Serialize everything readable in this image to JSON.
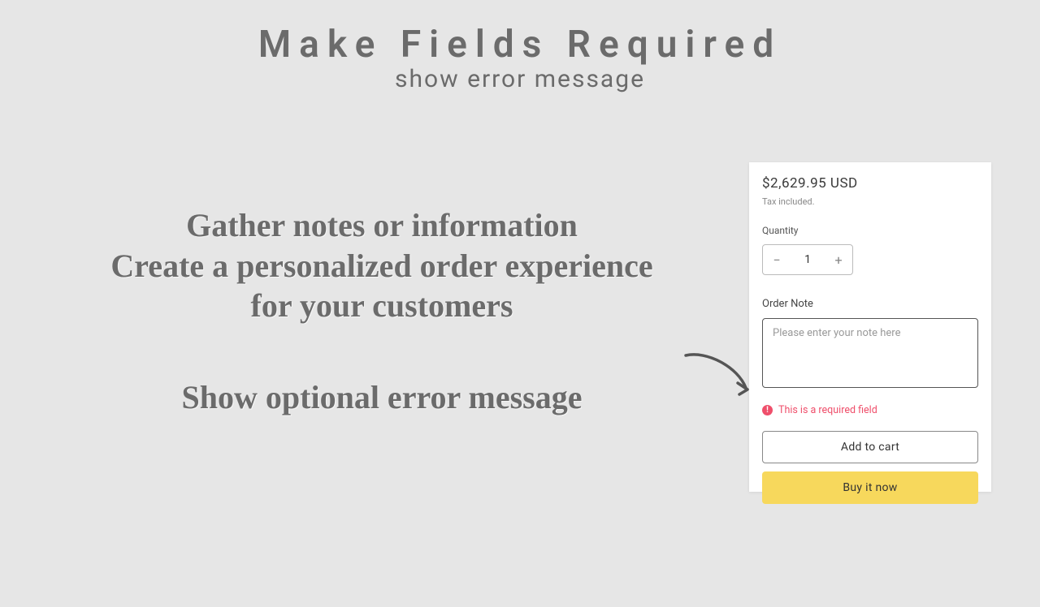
{
  "title": {
    "main": "Make Fields Required",
    "sub": "show error message"
  },
  "marketing": {
    "line1": "Gather notes or information",
    "line2": "Create a personalized order experience",
    "line3": "for your customers",
    "line4": "Show optional error message"
  },
  "card": {
    "price": "$2,629.95 USD",
    "tax": "Tax included.",
    "quantity_label": "Quantity",
    "quantity_value": "1",
    "quantity_minus": "−",
    "quantity_plus": "+",
    "note_label": "Order Note",
    "note_placeholder": "Please enter your note here",
    "error_glyph": "!",
    "error_text": "This is a required field",
    "add_to_cart": "Add to cart",
    "buy_now": "Buy it now"
  },
  "colors": {
    "error": "#ef4f6b",
    "primary_button": "#f7d85c"
  }
}
